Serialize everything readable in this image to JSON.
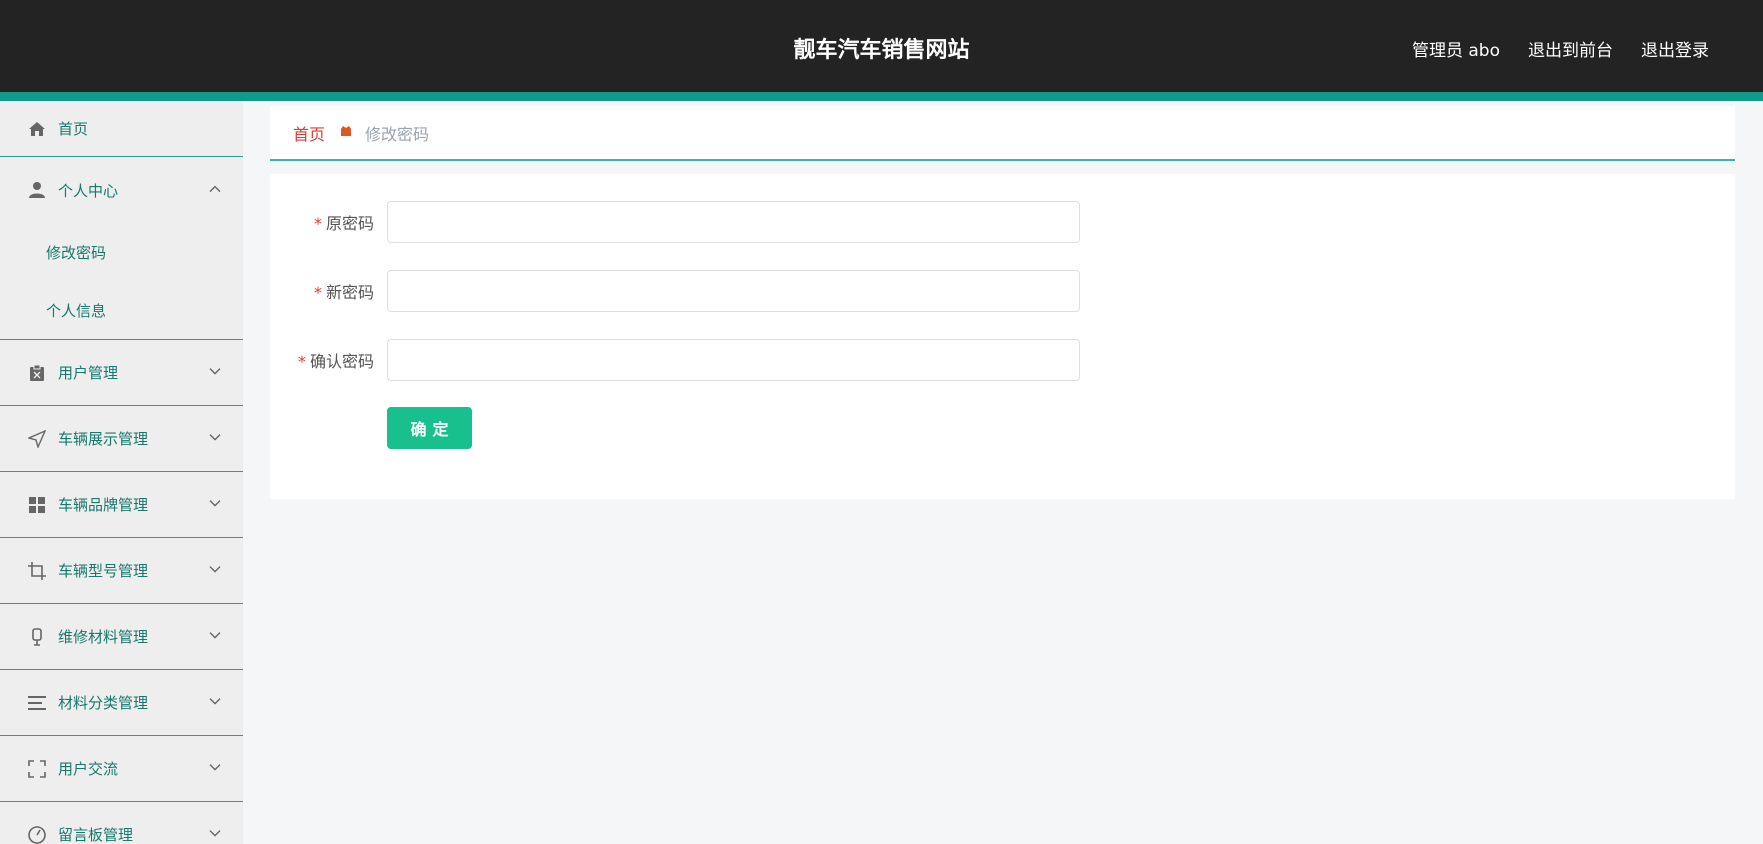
{
  "header": {
    "title": "靓车汽车销售网站",
    "user_label": "管理员 abo",
    "back_to_front": "退出到前台",
    "logout": "退出登录"
  },
  "sidebar": {
    "home": "首页",
    "personal_center": "个人中心",
    "personal_sub": [
      "修改密码",
      "个人信息"
    ],
    "items": [
      {
        "label": "用户管理",
        "icon": "clipboard-icon"
      },
      {
        "label": "车辆展示管理",
        "icon": "navigation-icon"
      },
      {
        "label": "车辆品牌管理",
        "icon": "grid-icon"
      },
      {
        "label": "车辆型号管理",
        "icon": "crop-icon"
      },
      {
        "label": "维修材料管理",
        "icon": "microphone-icon"
      },
      {
        "label": "材料分类管理",
        "icon": "list-icon"
      },
      {
        "label": "用户交流",
        "icon": "fullscreen-icon"
      },
      {
        "label": "留言板管理",
        "icon": "gauge-icon"
      }
    ]
  },
  "breadcrumb": {
    "home": "首页",
    "current": "修改密码"
  },
  "form": {
    "required_mark": "*",
    "old_password_label": "原密码",
    "new_password_label": "新密码",
    "confirm_password_label": "确认密码",
    "old_password_value": "",
    "new_password_value": "",
    "confirm_password_value": "",
    "submit_label": "确定"
  },
  "colors": {
    "header_bg": "#232323",
    "accent": "#0f9a8a",
    "menu_text": "#16796c",
    "button": "#17c08d",
    "breadcrumb_home": "#e53935"
  }
}
